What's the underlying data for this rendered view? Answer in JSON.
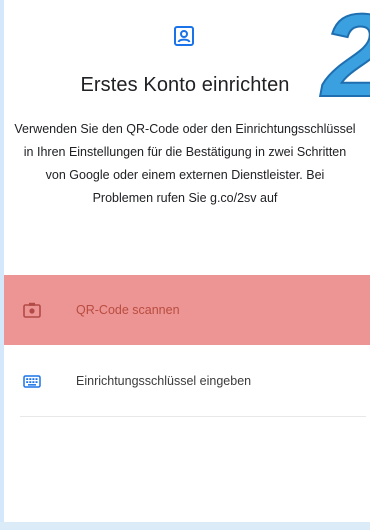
{
  "header": {
    "title": "Erstes Konto einrichten",
    "description": "Verwenden Sie den QR-Code oder den Einrichtungsschlüssel in Ihren Einstellungen für die Bestätigung in zwei Schritten von Google oder einem externen Dienstleister. Bei Problemen rufen Sie g.co/2sv auf",
    "icon": "account-box-icon"
  },
  "options": [
    {
      "label": "QR-Code scannen",
      "icon": "camera-icon",
      "highlighted": true
    },
    {
      "label": "Einrichtungsschlüssel eingeben",
      "icon": "keyboard-icon",
      "highlighted": false
    }
  ],
  "overlay": {
    "text": "2",
    "color": "#3aa0e0"
  },
  "colors": {
    "accent": "#1a73e8",
    "highlight": "#ed9494",
    "highlight_text": "#b94d3f"
  }
}
